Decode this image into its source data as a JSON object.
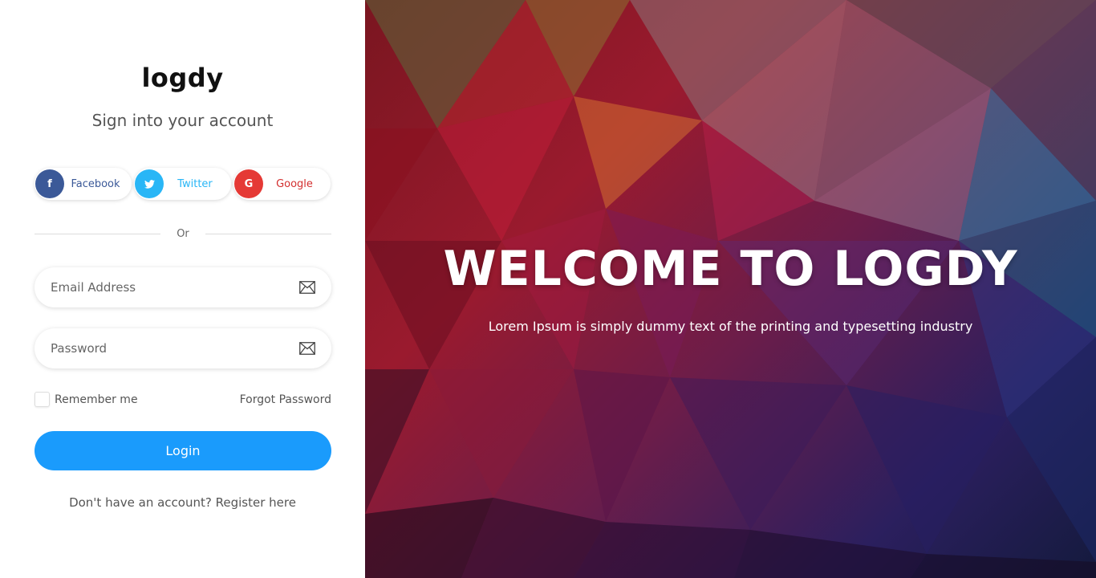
{
  "brand": {
    "logo": "logdy"
  },
  "signin": {
    "subtitle": "Sign into your account"
  },
  "social": {
    "facebook": {
      "label": "Facebook",
      "glyph": "f"
    },
    "twitter": {
      "label": "Twitter"
    },
    "google": {
      "label": "Google",
      "glyph": "G"
    }
  },
  "divider": {
    "label": "Or"
  },
  "form": {
    "email_placeholder": "Email Address",
    "password_placeholder": "Password",
    "remember_label": "Remember me",
    "forgot_label": "Forgot Password",
    "login_label": "Login",
    "register_text": "Don't have an account? Register here"
  },
  "hero": {
    "title": "WELCOME TO LOGDY",
    "subtitle": "Lorem Ipsum is simply dummy text of the printing and typesetting industry"
  },
  "colors": {
    "primary": "#1a9bfc",
    "facebook": "#3b5998",
    "twitter": "#29b6f6",
    "google": "#e53935"
  },
  "icons": [
    "facebook-icon",
    "twitter-icon",
    "google-icon",
    "envelope-icon"
  ]
}
